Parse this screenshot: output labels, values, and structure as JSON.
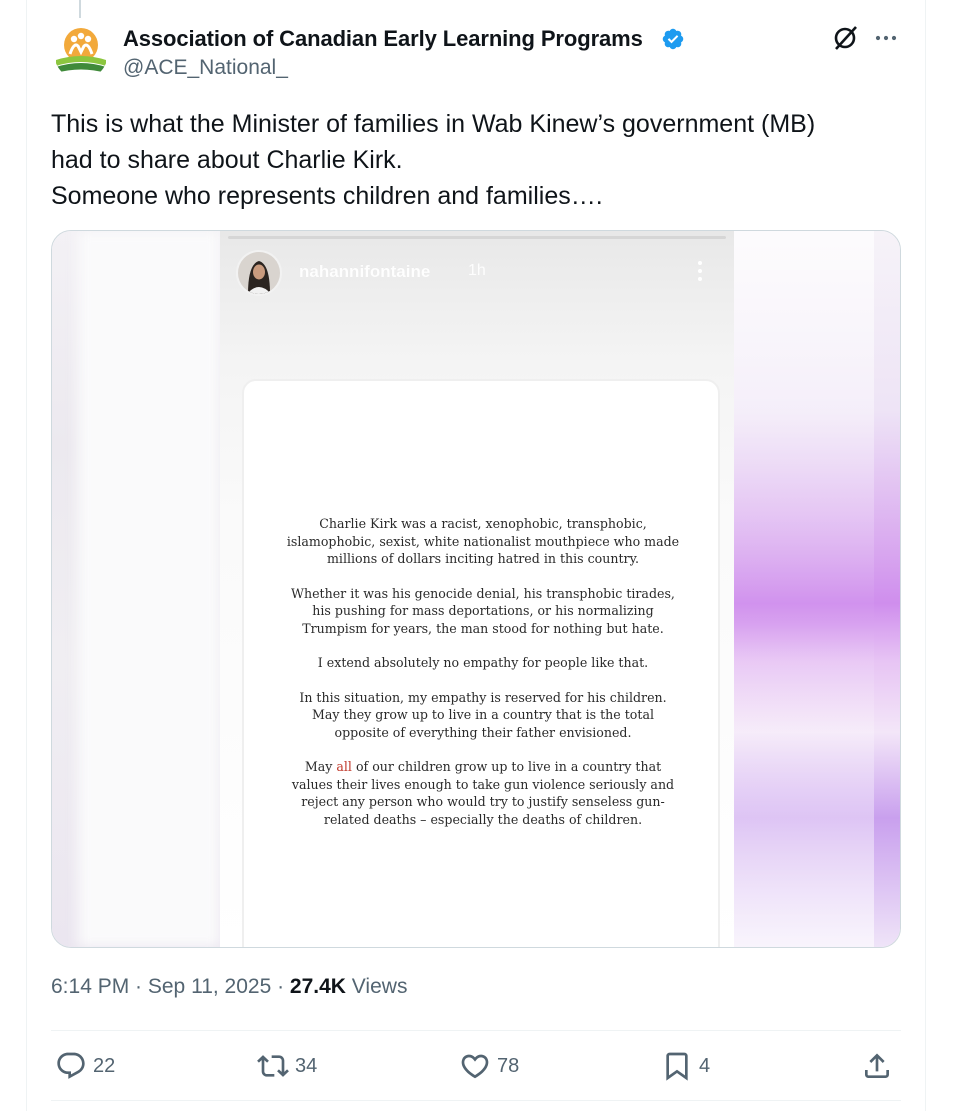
{
  "tweet": {
    "author_name": "Association of Canadian Early Learning Programs",
    "handle": "@ACE_National_",
    "text_lines": [
      "This is what the Minister of families in Wab Kinew’s government (MB)",
      "had to share about Charlie Kirk.",
      "Someone who represents children and families…."
    ],
    "timestamp": "6:14 PM · Sep 11, 2025 · ",
    "views_count": "27.4K",
    "views_label": " Views"
  },
  "story": {
    "username": "nahannifontaine",
    "time": "1h",
    "paragraphs": [
      "Charlie Kirk was a racist, xenophobic, transphobic,\nislamophobic, sexist, white nationalist mouthpiece who made\nmillions of dollars inciting hatred in this country.",
      "Whether it was his genocide denial, his transphobic tirades,\nhis pushing for mass deportations, or his normalizing\nTrumpism for years, the man stood for nothing but hate.",
      "I extend absolutely no empathy for people like that.",
      "In this situation, my empathy is reserved for his children.\nMay they grow up to live in a country that is the total\nopposite of everything their father envisioned."
    ],
    "last_paragraph": {
      "before": "May ",
      "accent": "all",
      "after": " of our children grow up to live in a country that\nvalues their lives enough to take gun violence seriously and\nreject any person who would try to justify senseless gun-\nrelated deaths – especially the deaths of children."
    }
  },
  "actions": {
    "replies": "22",
    "reposts": "34",
    "likes": "78",
    "bookmarks": "4"
  },
  "icons": {
    "verified": "verified-badge-icon",
    "grok": "grok-icon",
    "more": "more-options-icon",
    "reply": "reply-icon",
    "repost": "repost-icon",
    "like": "heart-icon",
    "bookmark": "bookmark-icon",
    "share": "share-icon"
  },
  "colors": {
    "verified_blue": "#1d9bf0",
    "text_primary": "#0f1419",
    "text_secondary": "#536471",
    "accent_red": "#c0392b"
  }
}
